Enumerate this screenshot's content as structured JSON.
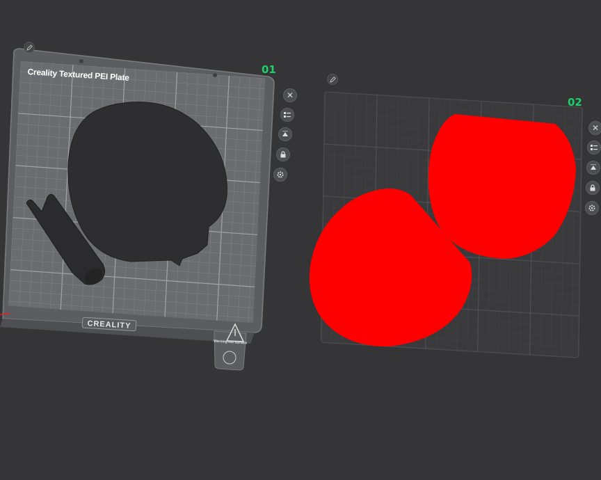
{
  "plates": [
    {
      "number": "01",
      "label": "Creality Textured PEI Plate",
      "brand": "CREALITY",
      "warning": "Warning hot surface",
      "buttons": [
        {
          "name": "close-icon",
          "glyph": "✕"
        },
        {
          "name": "arrange-icon"
        },
        {
          "name": "auto-orient-icon"
        },
        {
          "name": "lock-icon"
        },
        {
          "name": "settings-icon"
        }
      ]
    },
    {
      "number": "02",
      "buttons": [
        {
          "name": "close-icon",
          "glyph": "✕"
        },
        {
          "name": "arrange-icon"
        },
        {
          "name": "auto-orient-icon"
        },
        {
          "name": "lock-icon"
        },
        {
          "name": "settings-icon"
        }
      ]
    }
  ],
  "colors": {
    "background": "#353537",
    "plate_bed": "#6e6f72",
    "model_dark": "#2f2f30",
    "model_selected": "#ff0000",
    "plate_number": "#1fcf6a"
  }
}
